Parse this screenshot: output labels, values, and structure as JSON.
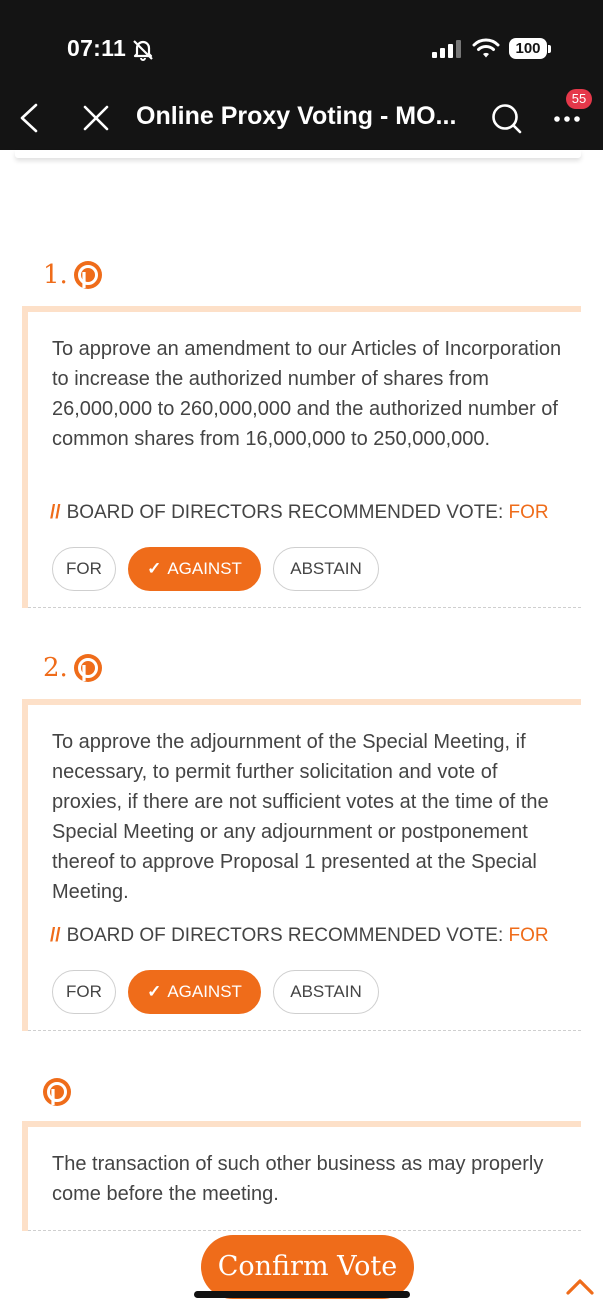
{
  "status_bar": {
    "time": "07:11",
    "battery": "100"
  },
  "nav": {
    "title": "Online Proxy Voting - MO...",
    "notification_count": "55"
  },
  "proposals": [
    {
      "number": "1.",
      "text": "To approve an amendment to our Articles of Incorporation to increase the authorized number of shares from 26,000,000 to 260,000,000 and the authorized number of common shares from 16,000,000 to 250,000,000.",
      "rec_prefix": "//",
      "rec_label": "BOARD OF DIRECTORS RECOMMENDED VOTE:",
      "rec_value": "FOR",
      "options": [
        "FOR",
        "AGAINST",
        "ABSTAIN"
      ],
      "selected": "AGAINST"
    },
    {
      "number": "2.",
      "text": "To approve the adjournment of the Special Meeting, if necessary, to permit further solicitation and vote of proxies, if there are not sufficient votes at the time of the Special Meeting or any adjournment or postponement thereof to approve Proposal 1 presented at the Special Meeting.",
      "rec_prefix": "//",
      "rec_label": "BOARD OF DIRECTORS RECOMMENDED VOTE:",
      "rec_value": "FOR",
      "options": [
        "FOR",
        "AGAINST",
        "ABSTAIN"
      ],
      "selected": "AGAINST"
    },
    {
      "number": "",
      "text": "The transaction of such other business as may properly come before the meeting."
    }
  ],
  "confirm_label": "Confirm Vote",
  "colors": {
    "accent": "#ef6c1a",
    "accent_light": "#fde0c8",
    "bar": "#141414",
    "badge": "#e5384a"
  },
  "icons": [
    "bell-muted-icon",
    "signal-icon",
    "wifi-icon",
    "battery-icon",
    "back-chevron-icon",
    "close-icon",
    "search-icon",
    "more-icon",
    "proxy-p-icon",
    "scroll-top-chevron-icon"
  ]
}
